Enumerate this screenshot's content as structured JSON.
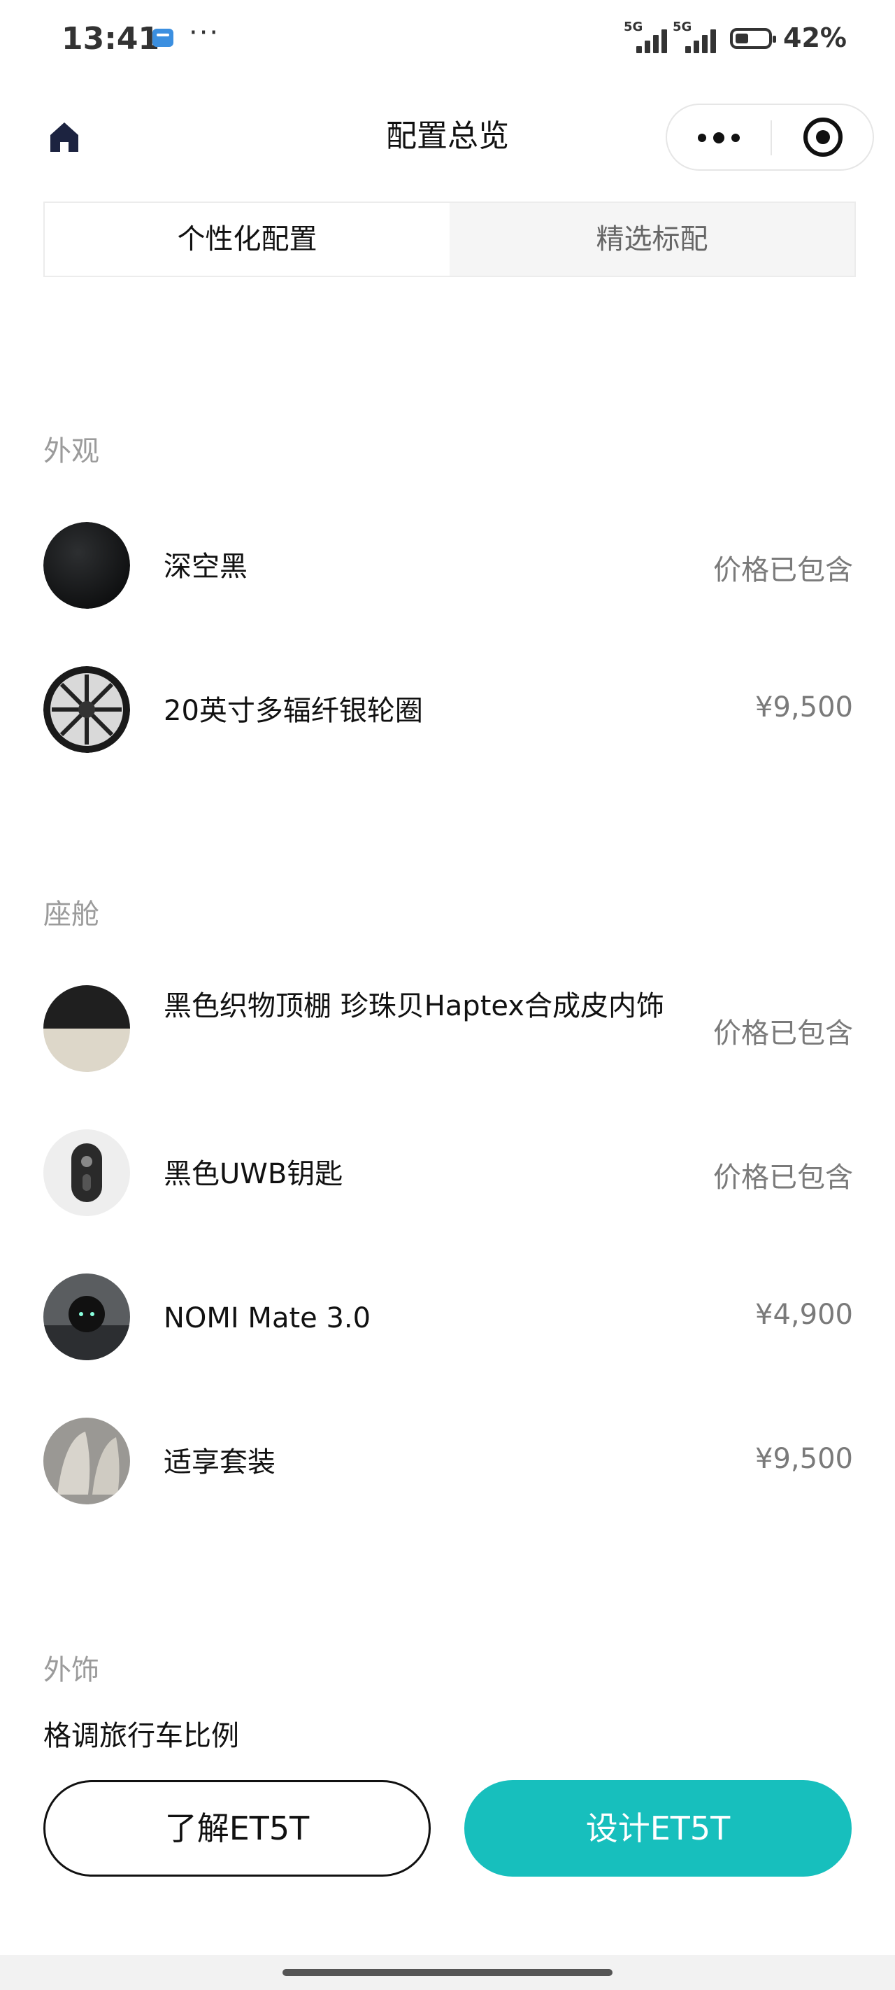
{
  "status_bar": {
    "time": "13:41",
    "dots": "···",
    "signal1_label": "5G",
    "signal2_label": "5G",
    "battery_percent": "42%",
    "battery_level": 0.42
  },
  "nav": {
    "title": "配置总览",
    "home_icon": "home-icon",
    "more_icon": "more-dots-icon",
    "close_icon": "target-close-icon"
  },
  "tabs": [
    {
      "label": "个性化配置",
      "active": true
    },
    {
      "label": "精选标配",
      "active": false
    }
  ],
  "sections": [
    {
      "title": "外观",
      "items": [
        {
          "name": "深空黑",
          "price": "价格已包含"
        },
        {
          "name": "20英寸多辐纤银轮圈",
          "price": "¥9,500"
        }
      ]
    },
    {
      "title": "座舱",
      "items": [
        {
          "name": "黑色织物顶棚 珍珠贝Haptex合成皮内饰",
          "price": "价格已包含"
        },
        {
          "name": "黑色UWB钥匙",
          "price": "价格已包含"
        },
        {
          "name": "NOMI Mate 3.0",
          "price": "¥4,900"
        },
        {
          "name": "适享套装",
          "price": "¥9,500"
        }
      ]
    },
    {
      "title": "外饰",
      "items": [
        {
          "name": "格调旅行车比例"
        }
      ]
    }
  ],
  "buttons": {
    "learn": "了解ET5T",
    "design": "设计ET5T"
  },
  "colors": {
    "accent": "#17bfbd",
    "section_title": "#9b9b9b",
    "price": "#7a7a7a"
  }
}
